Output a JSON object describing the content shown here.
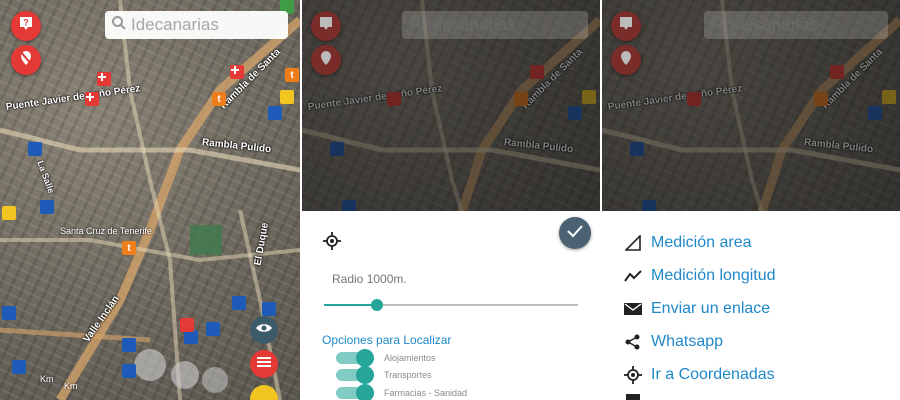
{
  "search": {
    "placeholder": "Idecanarias"
  },
  "map": {
    "labels": {
      "rambla_santa": "Rambla de Santa",
      "rambla_pulido": "Rambla Pulido",
      "puente_javier": "Puente Javier de Leño Pérez",
      "santa_cruz": "Santa Cruz de Tenerife",
      "valle_inclan": "Valle Inclán",
      "la_salle": "La Salle",
      "dulce_villalba": "El Duque",
      "km": "Km",
      "km2": "Km"
    }
  },
  "radius_panel": {
    "radio_label": "Radio 1000m.",
    "slider_value": 0.21,
    "options_title": "Opciones para Localizar",
    "options": [
      {
        "label": "Alojamientos",
        "on": true
      },
      {
        "label": "Transportes",
        "on": true
      },
      {
        "label": "Farmacias - Sanidad",
        "on": true
      }
    ]
  },
  "tools_menu": {
    "items": [
      {
        "label": "Medición area",
        "icon": "area-measure-icon"
      },
      {
        "label": "Medición longitud",
        "icon": "line-measure-icon"
      },
      {
        "label": "Enviar un enlace",
        "icon": "mail-icon"
      },
      {
        "label": "Whatsapp",
        "icon": "share-icon"
      },
      {
        "label": "Ir a Coordenadas",
        "icon": "gps-target-icon"
      }
    ]
  },
  "colors": {
    "accent_red": "#e53935",
    "link_blue": "#1e88c8",
    "teal": "#26a69a",
    "fab_slate": "#4a6272"
  }
}
